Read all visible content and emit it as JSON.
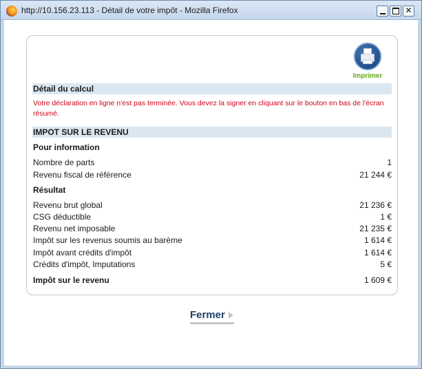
{
  "window": {
    "title": "http://10.156.23.113 - Détail de votre impôt - Mozilla Firefox",
    "buttons": {
      "minimize": "",
      "maximize": "",
      "close": "✕"
    }
  },
  "print": {
    "label": "Imprimer",
    "icon": "printer-icon"
  },
  "detail": {
    "heading": "Détail du calcul",
    "warning": "Votre déclaration en ligne n'est pas terminée. Vous devez la signer en cliquant sur le bouton en bas de l'écran résumé."
  },
  "income_tax": {
    "heading": "IMPOT SUR LE REVENU",
    "info_heading": "Pour information",
    "info_rows": [
      {
        "label": "Nombre de parts",
        "value": "1"
      },
      {
        "label": "Revenu fiscal de référence",
        "value": "21 244 €"
      }
    ],
    "result_heading": "Résultat",
    "result_rows": [
      {
        "label": "Revenu brut global",
        "value": "21 236 €"
      },
      {
        "label": "CSG déductible",
        "value": "1 €"
      },
      {
        "label": "Revenu net imposable",
        "value": "21 235 €"
      },
      {
        "label": "Impôt sur les revenus soumis au barème",
        "value": "1 614 €"
      },
      {
        "label": "Impôt avant crédits d'impôt",
        "value": "1 614 €"
      },
      {
        "label": "Crédits d'impôt, Imputations",
        "value": "5 €"
      }
    ],
    "total": {
      "label": "Impôt sur le revenu",
      "value": "1 609 €"
    }
  },
  "footer": {
    "close_label": "Fermer"
  },
  "colors": {
    "accent": "#1f3f66",
    "warning": "#d0021b",
    "section_bg": "#dbe7f0",
    "print_green": "#6aa51b"
  }
}
